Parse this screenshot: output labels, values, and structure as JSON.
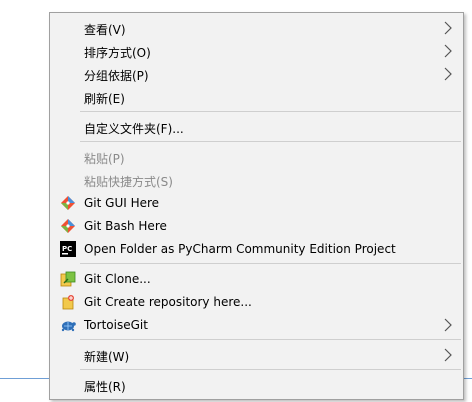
{
  "menu": {
    "items": [
      {
        "label": "查看(V)",
        "has_submenu": true
      },
      {
        "label": "排序方式(O)",
        "has_submenu": true
      },
      {
        "label": "分组依据(P)",
        "has_submenu": true
      },
      {
        "label": "刷新(E)"
      },
      {
        "label": "自定义文件夹(F)..."
      },
      {
        "label": "粘贴(P)",
        "disabled": true
      },
      {
        "label": "粘贴快捷方式(S)",
        "disabled": true
      },
      {
        "label": "Git GUI Here",
        "icon": "git-diamond-icon"
      },
      {
        "label": "Git Bash Here",
        "icon": "git-diamond-icon"
      },
      {
        "label": "Open Folder as PyCharm Community Edition Project",
        "icon": "pycharm-icon"
      },
      {
        "label": "Git Clone...",
        "icon": "tortoisegit-clone-icon"
      },
      {
        "label": "Git Create repository here...",
        "icon": "tortoisegit-create-repo-icon"
      },
      {
        "label": "TortoiseGit",
        "icon": "tortoisegit-icon",
        "has_submenu": true
      },
      {
        "label": "新建(W)",
        "has_submenu": true
      },
      {
        "label": "属性(R)"
      }
    ]
  },
  "colors": {
    "menu_bg": "#f2f2f2",
    "disabled_text": "#8a8a8a",
    "separator": "#cfcfcf",
    "desktop_accent_line": "#6f9fd6"
  }
}
